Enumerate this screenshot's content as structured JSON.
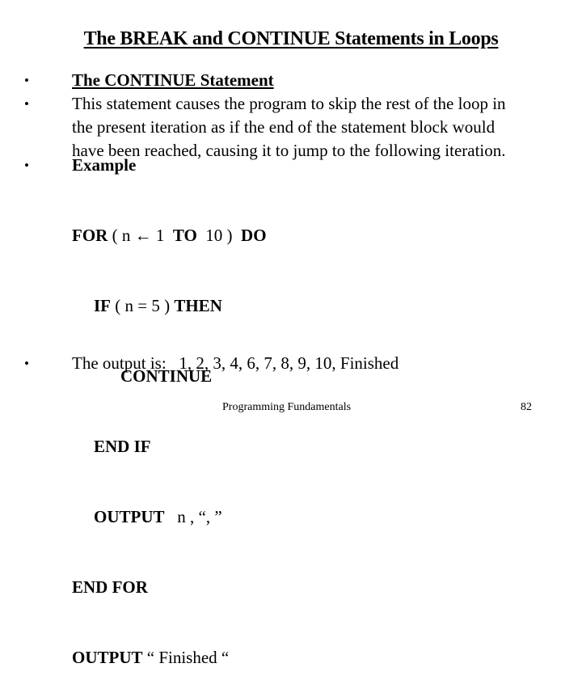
{
  "slide": {
    "title": "The BREAK and CONTINUE Statements in Loops",
    "bullets": [
      {
        "icon": "bullet-dot",
        "text": "The CONTINUE Statement"
      },
      {
        "icon": "bullet-dot",
        "lines": [
          "This statement causes the program to skip the rest of the loop in",
          "the present iteration as if the end of the statement block would",
          "have been reached, causing it to jump to the following iteration."
        ]
      },
      {
        "icon": "bullet-dot",
        "text": "Example"
      },
      {
        "icon": "bullet-dot",
        "text": "The output is:   1, 2, 3, 4, 6, 7, 8, 9, 10, Finished"
      }
    ],
    "bullet_glyph": "•",
    "code": {
      "for_kw": "FOR",
      "for_rest": " ( n ",
      "arrow": "←",
      "for_rest2": " 1  ",
      "to_kw": "TO",
      "for_rest3": "  10 )  ",
      "do_kw": "DO",
      "if_kw": "IF",
      "if_rest": " ( n = 5 ) ",
      "then_kw": "THEN",
      "continue_kw": "CONTINUE",
      "endif_kw": "END IF",
      "output_kw": "OUTPUT",
      "output_rest": "   n , “, ”",
      "endfor_kw": "END FOR",
      "output2_kw": "OUTPUT",
      "output2_rest": " “ Finished “"
    },
    "footer": {
      "course": "Programming Fundamentals",
      "page_number": "82"
    }
  }
}
